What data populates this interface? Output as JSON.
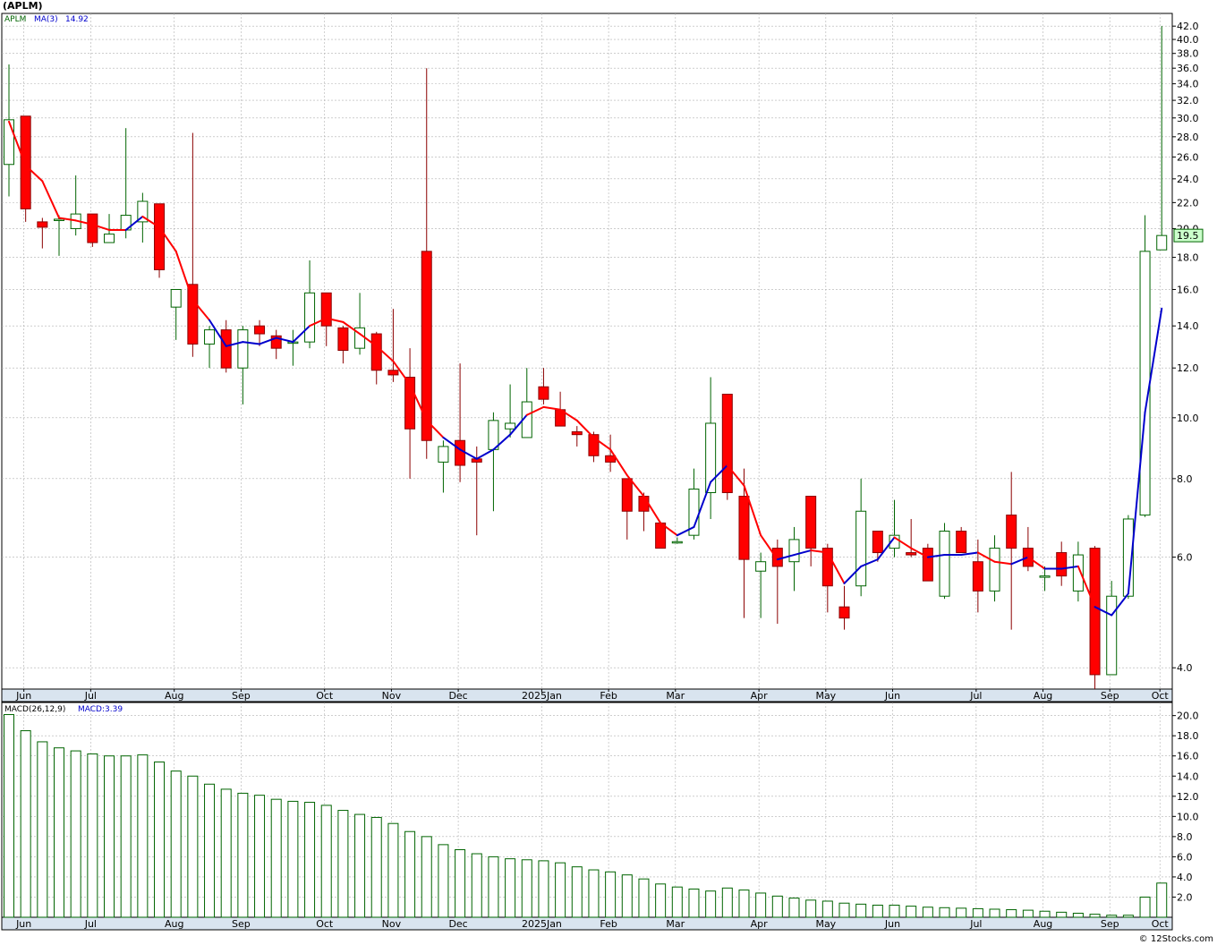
{
  "title": "(APLM)",
  "credit": "© 12Stocks.com",
  "colors": {
    "up": "#006400",
    "down": "#ff0000",
    "ma_up": "#0000cc",
    "ma_down": "#ff0000",
    "price_tag_bg": "#ccffcc",
    "grid": "#b0b0b0",
    "volume": "#006400"
  },
  "chart_data": [
    {
      "type": "candlestick",
      "scale": "log",
      "ticker_label": "APLM",
      "ma_label": "MA(3)",
      "ma_value": "14.92",
      "last_price_label": "19.5",
      "y_ticks": [
        4.0,
        6.0,
        8.0,
        10.0,
        12.0,
        14.0,
        16.0,
        18.0,
        20.0,
        22.0,
        24.0,
        26.0,
        28.0,
        30.0,
        32.0,
        34.0,
        36.0,
        38.0,
        40.0,
        42.0
      ],
      "ylim": [
        3.7,
        44
      ],
      "months": [
        {
          "label": "Jun",
          "at": 1
        },
        {
          "label": "Jul",
          "at": 5
        },
        {
          "label": "Aug",
          "at": 10
        },
        {
          "label": "Sep",
          "at": 14
        },
        {
          "label": "Oct",
          "at": 19
        },
        {
          "label": "Nov",
          "at": 23
        },
        {
          "label": "Dec",
          "at": 27
        },
        {
          "label": "2025Jan",
          "at": 32
        },
        {
          "label": "Feb",
          "at": 36
        },
        {
          "label": "Mar",
          "at": 40
        },
        {
          "label": "Apr",
          "at": 45
        },
        {
          "label": "May",
          "at": 49
        },
        {
          "label": "Jun",
          "at": 53
        },
        {
          "label": "Jul",
          "at": 58
        },
        {
          "label": "Aug",
          "at": 62
        },
        {
          "label": "Sep",
          "at": 66
        },
        {
          "label": "Oct",
          "at": 69
        }
      ],
      "candles": [
        {
          "o": 25.3,
          "h": 36.5,
          "l": 22.5,
          "c": 29.8
        },
        {
          "o": 30.2,
          "h": 30.2,
          "l": 20.5,
          "c": 21.5
        },
        {
          "o": 20.5,
          "h": 20.8,
          "l": 18.6,
          "c": 20.1
        },
        {
          "o": 20.6,
          "h": 21.0,
          "l": 18.1,
          "c": 20.7
        },
        {
          "o": 20.0,
          "h": 24.3,
          "l": 19.5,
          "c": 21.1
        },
        {
          "o": 21.1,
          "h": 21.1,
          "l": 18.7,
          "c": 19.0
        },
        {
          "o": 19.0,
          "h": 21.1,
          "l": 19.0,
          "c": 19.6
        },
        {
          "o": 19.9,
          "h": 28.9,
          "l": 19.3,
          "c": 21.0
        },
        {
          "o": 20.5,
          "h": 22.8,
          "l": 19.0,
          "c": 22.1
        },
        {
          "o": 21.9,
          "h": 21.9,
          "l": 16.7,
          "c": 17.2
        },
        {
          "o": 15.0,
          "h": 16.0,
          "l": 13.3,
          "c": 16.0
        },
        {
          "o": 16.3,
          "h": 28.4,
          "l": 12.5,
          "c": 13.1
        },
        {
          "o": 13.1,
          "h": 14.0,
          "l": 12.0,
          "c": 13.8
        },
        {
          "o": 13.8,
          "h": 14.3,
          "l": 11.8,
          "c": 12.0
        },
        {
          "o": 12.0,
          "h": 14.0,
          "l": 10.5,
          "c": 13.8
        },
        {
          "o": 14.0,
          "h": 14.3,
          "l": 13.0,
          "c": 13.6
        },
        {
          "o": 13.5,
          "h": 13.8,
          "l": 12.4,
          "c": 12.9
        },
        {
          "o": 13.2,
          "h": 13.8,
          "l": 12.1,
          "c": 13.2
        },
        {
          "o": 13.2,
          "h": 17.8,
          "l": 12.9,
          "c": 15.8
        },
        {
          "o": 15.8,
          "h": 15.8,
          "l": 13.0,
          "c": 14.0
        },
        {
          "o": 13.9,
          "h": 14.0,
          "l": 12.2,
          "c": 12.8
        },
        {
          "o": 12.9,
          "h": 15.8,
          "l": 12.6,
          "c": 13.9
        },
        {
          "o": 13.6,
          "h": 13.7,
          "l": 11.3,
          "c": 11.9
        },
        {
          "o": 11.9,
          "h": 14.9,
          "l": 11.4,
          "c": 11.7
        },
        {
          "o": 11.6,
          "h": 12.9,
          "l": 8.0,
          "c": 9.6
        },
        {
          "o": 18.4,
          "h": 36.0,
          "l": 8.6,
          "c": 9.2
        },
        {
          "o": 8.5,
          "h": 9.2,
          "l": 7.6,
          "c": 9.0
        },
        {
          "o": 9.2,
          "h": 12.2,
          "l": 7.9,
          "c": 8.4
        },
        {
          "o": 8.6,
          "h": 9.0,
          "l": 6.5,
          "c": 8.5
        },
        {
          "o": 8.9,
          "h": 10.2,
          "l": 7.1,
          "c": 9.9
        },
        {
          "o": 9.6,
          "h": 11.3,
          "l": 9.3,
          "c": 9.8
        },
        {
          "o": 9.3,
          "h": 12.0,
          "l": 9.3,
          "c": 10.6
        },
        {
          "o": 11.2,
          "h": 12.0,
          "l": 10.5,
          "c": 10.7
        },
        {
          "o": 10.3,
          "h": 11.0,
          "l": 9.7,
          "c": 9.7
        },
        {
          "o": 9.5,
          "h": 9.7,
          "l": 9.0,
          "c": 9.4
        },
        {
          "o": 9.4,
          "h": 9.5,
          "l": 8.5,
          "c": 8.7
        },
        {
          "o": 8.7,
          "h": 9.4,
          "l": 8.2,
          "c": 8.5
        },
        {
          "o": 8.0,
          "h": 8.0,
          "l": 6.4,
          "c": 7.1
        },
        {
          "o": 7.5,
          "h": 7.6,
          "l": 6.6,
          "c": 7.1
        },
        {
          "o": 6.8,
          "h": 6.8,
          "l": 6.2,
          "c": 6.2
        },
        {
          "o": 6.35,
          "h": 6.45,
          "l": 6.3,
          "c": 6.35
        },
        {
          "o": 6.5,
          "h": 8.3,
          "l": 6.4,
          "c": 7.7
        },
        {
          "o": 7.6,
          "h": 11.6,
          "l": 6.9,
          "c": 9.8
        },
        {
          "o": 10.9,
          "h": 10.9,
          "l": 7.4,
          "c": 7.6
        },
        {
          "o": 7.5,
          "h": 8.3,
          "l": 4.8,
          "c": 5.95
        },
        {
          "o": 5.7,
          "h": 6.1,
          "l": 4.8,
          "c": 5.9
        },
        {
          "o": 6.2,
          "h": 6.4,
          "l": 4.7,
          "c": 5.8
        },
        {
          "o": 5.9,
          "h": 6.7,
          "l": 5.3,
          "c": 6.4
        },
        {
          "o": 7.5,
          "h": 7.5,
          "l": 5.8,
          "c": 6.2
        },
        {
          "o": 6.2,
          "h": 6.3,
          "l": 4.9,
          "c": 5.4
        },
        {
          "o": 5.0,
          "h": 5.4,
          "l": 4.6,
          "c": 4.8
        },
        {
          "o": 5.4,
          "h": 8.0,
          "l": 5.2,
          "c": 7.1
        },
        {
          "o": 6.6,
          "h": 6.6,
          "l": 5.9,
          "c": 6.1
        },
        {
          "o": 6.2,
          "h": 7.4,
          "l": 6.0,
          "c": 6.5
        },
        {
          "o": 6.1,
          "h": 6.9,
          "l": 6.0,
          "c": 6.05
        },
        {
          "o": 6.2,
          "h": 6.3,
          "l": 5.5,
          "c": 5.5
        },
        {
          "o": 5.2,
          "h": 6.8,
          "l": 5.15,
          "c": 6.6
        },
        {
          "o": 6.6,
          "h": 6.7,
          "l": 6.1,
          "c": 6.1
        },
        {
          "o": 5.9,
          "h": 6.4,
          "l": 4.9,
          "c": 5.3
        },
        {
          "o": 5.3,
          "h": 6.5,
          "l": 5.1,
          "c": 6.2
        },
        {
          "o": 7.0,
          "h": 8.2,
          "l": 4.6,
          "c": 6.2
        },
        {
          "o": 6.2,
          "h": 6.7,
          "l": 5.7,
          "c": 5.8
        },
        {
          "o": 5.6,
          "h": 5.8,
          "l": 5.3,
          "c": 5.6
        },
        {
          "o": 6.1,
          "h": 6.35,
          "l": 5.4,
          "c": 5.6
        },
        {
          "o": 5.3,
          "h": 6.35,
          "l": 5.1,
          "c": 6.05
        },
        {
          "o": 6.2,
          "h": 6.25,
          "l": 3.7,
          "c": 3.9
        },
        {
          "o": 3.9,
          "h": 5.5,
          "l": 3.9,
          "c": 5.2
        },
        {
          "o": 5.2,
          "h": 7.0,
          "l": 5.15,
          "c": 6.9
        },
        {
          "o": 7.0,
          "h": 21.0,
          "l": 6.95,
          "c": 18.4
        },
        {
          "o": 18.5,
          "h": 42.0,
          "l": 18.5,
          "c": 19.5
        }
      ],
      "ma3": [
        29.6,
        25.2,
        23.8,
        20.8,
        20.6,
        20.3,
        19.9,
        19.9,
        20.9,
        20.1,
        18.4,
        15.4,
        14.3,
        13.0,
        13.2,
        13.1,
        13.4,
        13.2,
        14.0,
        14.4,
        14.2,
        13.6,
        13.0,
        12.3,
        11.3,
        9.9,
        9.3,
        8.9,
        8.6,
        8.9,
        9.4,
        10.1,
        10.4,
        10.3,
        9.9,
        9.3,
        8.9,
        8.1,
        7.5,
        6.8,
        6.5,
        6.7,
        7.9,
        8.4,
        7.8,
        6.5,
        5.95,
        6.05,
        6.15,
        6.1,
        5.45,
        5.8,
        5.95,
        6.45,
        6.2,
        6.0,
        6.05,
        6.05,
        6.1,
        5.9,
        5.85,
        6.0,
        5.75,
        5.75,
        5.8,
        5.0,
        4.85,
        5.25,
        10.2,
        14.92
      ],
      "ma_color_up": [
        false,
        false,
        false,
        false,
        false,
        false,
        false,
        false,
        true,
        false,
        false,
        false,
        false,
        true,
        true,
        true,
        true,
        true,
        true,
        false,
        false,
        false,
        false,
        false,
        false,
        false,
        false,
        true,
        true,
        true,
        true,
        true,
        false,
        false,
        false,
        false,
        false,
        false,
        false,
        false,
        false,
        true,
        true,
        true,
        false,
        false,
        false,
        true,
        true,
        false,
        false,
        true,
        true,
        true,
        false,
        false,
        true,
        true,
        true,
        false,
        false,
        true,
        false,
        true,
        true,
        false,
        true,
        true,
        true,
        true
      ]
    },
    {
      "type": "bar",
      "indicator_label": "MACD(26,12,9)",
      "value_label": "MACD:3.39",
      "y_ticks": [
        2.0,
        4.0,
        6.0,
        8.0,
        10.0,
        12.0,
        14.0,
        16.0,
        18.0,
        20.0
      ],
      "ylim": [
        0,
        21.3
      ],
      "values": [
        20.1,
        18.5,
        17.4,
        16.8,
        16.5,
        16.2,
        16.0,
        16.0,
        16.1,
        15.4,
        14.5,
        14.0,
        13.2,
        12.7,
        12.3,
        12.1,
        11.7,
        11.5,
        11.4,
        11.1,
        10.6,
        10.2,
        9.9,
        9.3,
        8.5,
        8.0,
        7.2,
        6.7,
        6.3,
        6.0,
        5.8,
        5.7,
        5.6,
        5.4,
        5.0,
        4.7,
        4.5,
        4.2,
        3.8,
        3.3,
        3.0,
        2.8,
        2.6,
        2.9,
        2.7,
        2.4,
        2.1,
        1.9,
        1.7,
        1.6,
        1.4,
        1.3,
        1.2,
        1.2,
        1.1,
        1.0,
        0.95,
        0.9,
        0.85,
        0.8,
        0.75,
        0.7,
        0.6,
        0.5,
        0.4,
        0.3,
        0.2,
        0.2,
        2.0,
        3.39
      ]
    }
  ]
}
